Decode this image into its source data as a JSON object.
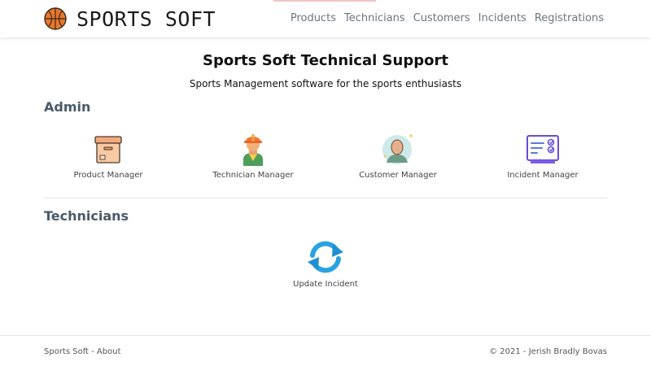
{
  "navbar": {
    "brand": "SPORTS SOFT",
    "brand_icon": "basketball-icon",
    "links": [
      "Products",
      "Technicians",
      "Customers",
      "Incidents",
      "Registrations"
    ]
  },
  "main": {
    "title": "Sports Soft Technical Support",
    "subtitle": "Sports Management software for the sports enthusiasts",
    "admin": {
      "heading": "Admin",
      "items": [
        {
          "label": "Product Manager",
          "icon": "box-icon"
        },
        {
          "label": "Technician Manager",
          "icon": "worker-icon"
        },
        {
          "label": "Customer Manager",
          "icon": "person-avatar-icon"
        },
        {
          "label": "Incident Manager",
          "icon": "checklist-icon"
        }
      ]
    },
    "technicians": {
      "heading": "Technicians",
      "items": [
        {
          "label": "Update Incident",
          "icon": "refresh-icon"
        }
      ]
    }
  },
  "footer": {
    "left": "Sports Soft - About",
    "right": "© 2021 - Jerish Bradly Bovas"
  },
  "colors": {
    "nav_link": "#6c757d",
    "section_heading": "#4a5a6a",
    "basketball": "#e8772e",
    "refresh_blue": "#29a3e0"
  }
}
